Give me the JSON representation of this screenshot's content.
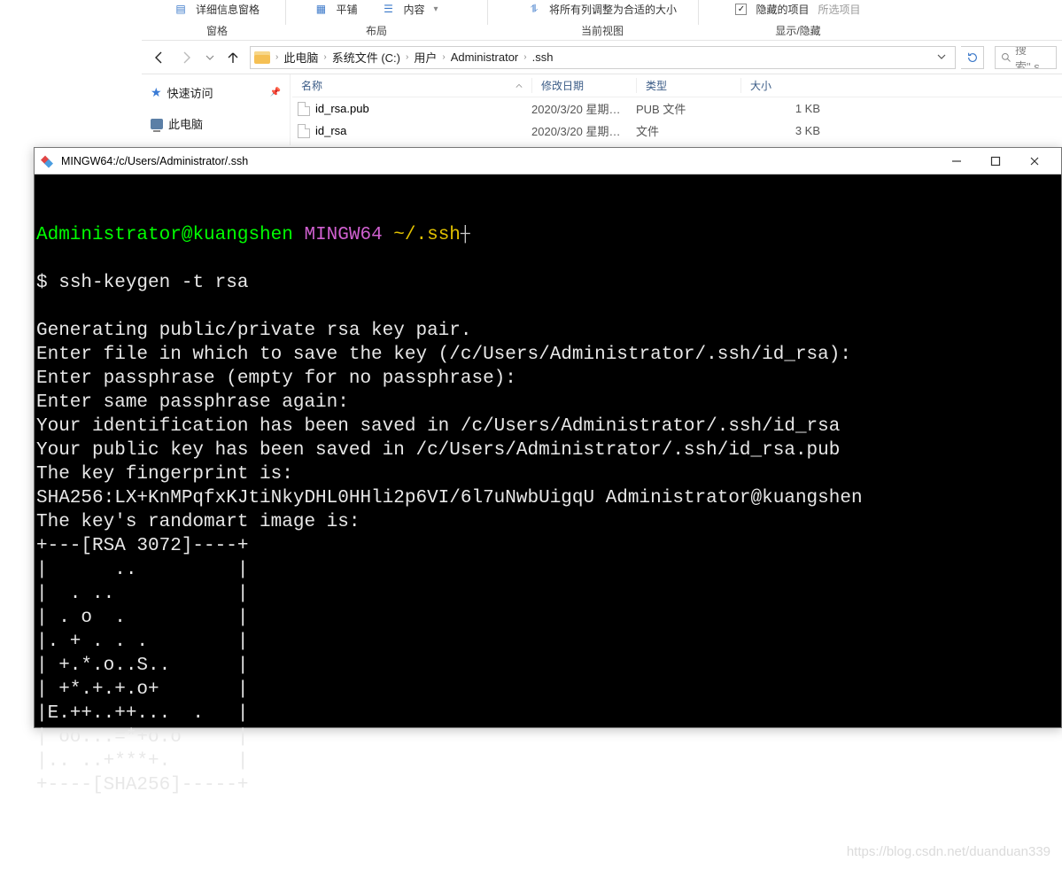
{
  "ribbon": {
    "details_label": "详细信息窗格",
    "tile_label": "平铺",
    "content_label": "内容",
    "fit_columns_label": "将所有列调整为合适的大小",
    "hidden_items_label": "隐藏的项目",
    "selected_items_label": "所选项目",
    "group_panes": "窗格",
    "group_layout": "布局",
    "group_currentview": "当前视图",
    "group_showhide": "显示/隐藏"
  },
  "nav": {
    "crumbs": [
      "此电脑",
      "系统文件 (C:)",
      "用户",
      "Administrator",
      ".ssh"
    ],
    "search_placeholder": "搜索\".s"
  },
  "columns": {
    "name": "名称",
    "date": "修改日期",
    "type": "类型",
    "size": "大小"
  },
  "tree": {
    "quick_access": "快速访问",
    "this_pc": "此电脑"
  },
  "files": [
    {
      "name": "id_rsa.pub",
      "date": "2020/3/20 星期…",
      "type": "PUB 文件",
      "size": "1 KB"
    },
    {
      "name": "id_rsa",
      "date": "2020/3/20 星期…",
      "type": "文件",
      "size": "3 KB"
    }
  ],
  "terminal": {
    "title": "MINGW64:/c/Users/Administrator/.ssh",
    "prompt_user": "Administrator",
    "prompt_host": "kuangshen",
    "prompt_env": "MINGW64",
    "prompt_path": "~/.ssh",
    "command": "ssh-keygen -t rsa",
    "output": "Generating public/private rsa key pair.\nEnter file in which to save the key (/c/Users/Administrator/.ssh/id_rsa):\nEnter passphrase (empty for no passphrase):\nEnter same passphrase again:\nYour identification has been saved in /c/Users/Administrator/.ssh/id_rsa\nYour public key has been saved in /c/Users/Administrator/.ssh/id_rsa.pub\nThe key fingerprint is:\nSHA256:LX+KnMPqfxKJtiNkyDHL0HHli2p6VI/6l7uNwbUigqU Administrator@kuangshen\nThe key's randomart image is:\n+---[RSA 3072]----+\n|      ..         |\n|  . ..           |\n| . o  .          |\n|. + . . .        |\n| +.*.o..S..      |\n| +*.+.+.o+       |\n|E.++..++...  .   |\n| oo...=*+o.o     |\n|.. ..+***+.      |\n+----[SHA256]-----+"
  },
  "watermark": "https://blog.csdn.net/duanduan339"
}
